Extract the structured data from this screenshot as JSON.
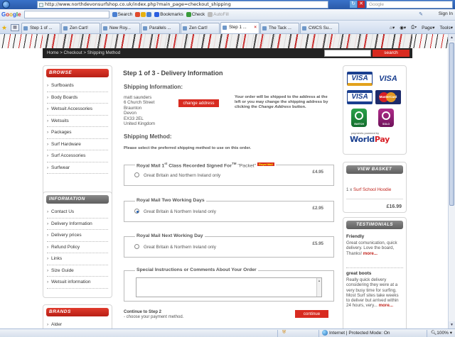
{
  "browser": {
    "url": "http://www.northdevonsurfshop.co.uk/index.php?main_page=checkout_shipping",
    "google_search_placeholder": "Google",
    "google_logo": [
      "G",
      "o",
      "o",
      "g",
      "l",
      "e"
    ],
    "toolbar": {
      "search": "Search",
      "bookmarks": "Bookmarks",
      "check": "Check",
      "autofill": "AutoFill",
      "sign_in": "Sign In"
    },
    "tabs": [
      {
        "label": "Step 1 of ...",
        "active": false
      },
      {
        "label": "Zen Cart!",
        "active": false
      },
      {
        "label": "New Roy...",
        "active": false
      },
      {
        "label": "Parallels ...",
        "active": false
      },
      {
        "label": "Zen Cart!",
        "active": false
      },
      {
        "label": "Step 1 ...",
        "active": true
      },
      {
        "label": "The Tack ...",
        "active": false
      },
      {
        "label": "CWCS Su...",
        "active": false
      }
    ],
    "tab_tools": {
      "page": "Page",
      "tools": "Tools"
    },
    "status": {
      "zone": "Internet | Protected Mode: On",
      "zoom": "100%"
    }
  },
  "site": {
    "breadcrumb": "Home > Checkout > Shipping Method",
    "search_button": "search",
    "sidebar": {
      "browse": {
        "heading": "BROWSE",
        "items": [
          "Surfboards",
          "Body Boards",
          "Wetsuit Accessories",
          "Wetsuits",
          "Packages",
          "Surf Hardware",
          "Surf Accessories",
          "Surfwear"
        ]
      },
      "information": {
        "heading": "INFORMATION",
        "items": [
          "Contact Us",
          "Delivery Information",
          "Delivery prices",
          "Refund Policy",
          "Links",
          "Size Guide",
          "Wetsuit information"
        ]
      },
      "brands": {
        "heading": "BRANDS",
        "items": [
          "Alder"
        ]
      }
    },
    "main": {
      "title": "Step 1 of 3 - Delivery Information",
      "shipping_info_title": "Shipping Information:",
      "address": [
        "matt saunders",
        "6 Church Street",
        "Braunton",
        "Devon",
        "EX33 2EL",
        "United Kingdom"
      ],
      "change_address_button": "change address",
      "address_note_1": "Your order will be shipped to the address at the left or you may change the shipping address by clicking the ",
      "address_note_em": "Change Address",
      "address_note_2": " button.",
      "shipping_method_title": "Shipping Method:",
      "method_note": "Please select the preferred shipping method to use on this order.",
      "options": [
        {
          "title_pre": "Royal Mail 1",
          "title_sup": "st",
          "title_mid": " Class Recorded Signed For",
          "title_tm": "TM",
          "title_post": " \"Packet\"",
          "badge": "Royal Mail",
          "label": "Great Britain and Northern Ireland only",
          "price": "£4.95",
          "checked": false
        },
        {
          "title": "Royal Mail Two Working Days",
          "label": "Great Britain & Northern Ireland only",
          "price": "£2.95",
          "checked": true
        },
        {
          "title": "Royal Mail Next Working Day",
          "label": "Great Britain & Northern Ireland only",
          "price": "£5.95",
          "checked": false
        }
      ],
      "instructions_title": "Special Instructions or Comments About Your Order",
      "continue_title": "Continue to Step 2",
      "continue_sub": "- choose your payment method.",
      "continue_button": "continue"
    },
    "payments": {
      "visa": "VISA",
      "visa_electron": "VISA",
      "electron": "ELECTRON",
      "mastercard": "MasterCard",
      "switch": "SWITCH",
      "solo": "SOLO",
      "powered_by": "payments powered by",
      "worldpay_1": "World",
      "worldpay_2": "Pay"
    },
    "basket": {
      "heading": "VIEW BASKET",
      "qty": "1 x ",
      "item": "Surf School Hoodie",
      "total": "£16.99"
    },
    "testimonials": {
      "heading": "TESTIMONIALS",
      "items": [
        {
          "title": "Friendly",
          "text": "Great comunication, quick delivery. Love the board, Thanks! ",
          "more": "more..."
        },
        {
          "title": "great boots",
          "text": "Really quick delivery considering they were at a very busy time for surfing. Most Surf sites take weeks to deliver but arrived within 24 hours, very... ",
          "more": "more..."
        }
      ]
    }
  }
}
